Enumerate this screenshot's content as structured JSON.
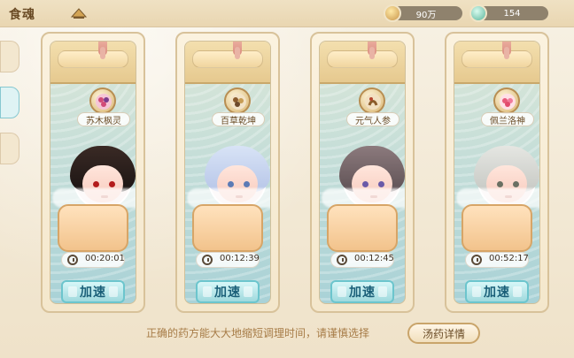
{
  "header": {
    "title": "食魂",
    "resource1": "90万",
    "resource2": "154"
  },
  "cards": [
    {
      "tag": "苏木枫灵",
      "timer": "00:20:01",
      "button": "加速"
    },
    {
      "tag": "百草乾坤",
      "timer": "00:12:39",
      "button": "加速"
    },
    {
      "tag": "元气人参",
      "timer": "00:12:45",
      "button": "加速"
    },
    {
      "tag": "佩兰洛神",
      "timer": "00:52:17",
      "button": "加速"
    }
  ],
  "footer": {
    "hint": "正确的药方能大大地缩短调理时间，请谨慎选择",
    "detail_button": "汤药详情"
  },
  "colors": {
    "accent": "#6cc5cd",
    "brown": "#6a4b25"
  }
}
